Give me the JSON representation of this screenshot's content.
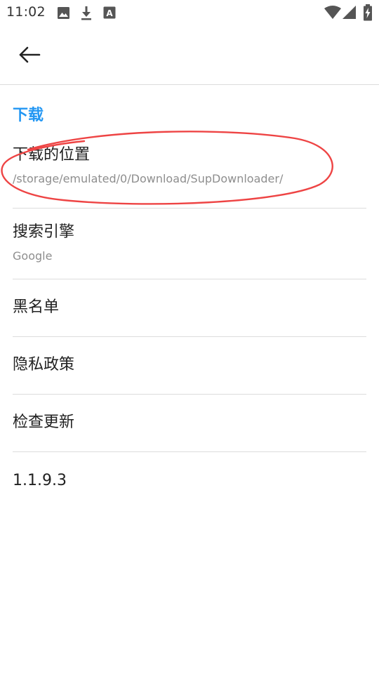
{
  "status_bar": {
    "time": "11:02",
    "icons": [
      "image-icon",
      "download-icon",
      "font-icon",
      "wifi-icon",
      "signal-icon",
      "battery-charging-icon"
    ]
  },
  "toolbar": {
    "back_icon": "arrow-left-icon"
  },
  "section": {
    "title": "下载"
  },
  "preferences": {
    "download_location": {
      "title": "下载的位置",
      "summary": "/storage/emulated/0/Download/SupDownloader/"
    },
    "search_engine": {
      "title": "搜索引擎",
      "summary": "Google"
    },
    "blacklist": {
      "title": "黑名单"
    },
    "privacy_policy": {
      "title": "隐私政策"
    },
    "check_update": {
      "title": "检查更新"
    },
    "version": {
      "title": "1.1.9.3"
    }
  },
  "colors": {
    "accent": "#2196f3",
    "annotation": "#ee4444",
    "divider": "#dcdcdc"
  }
}
